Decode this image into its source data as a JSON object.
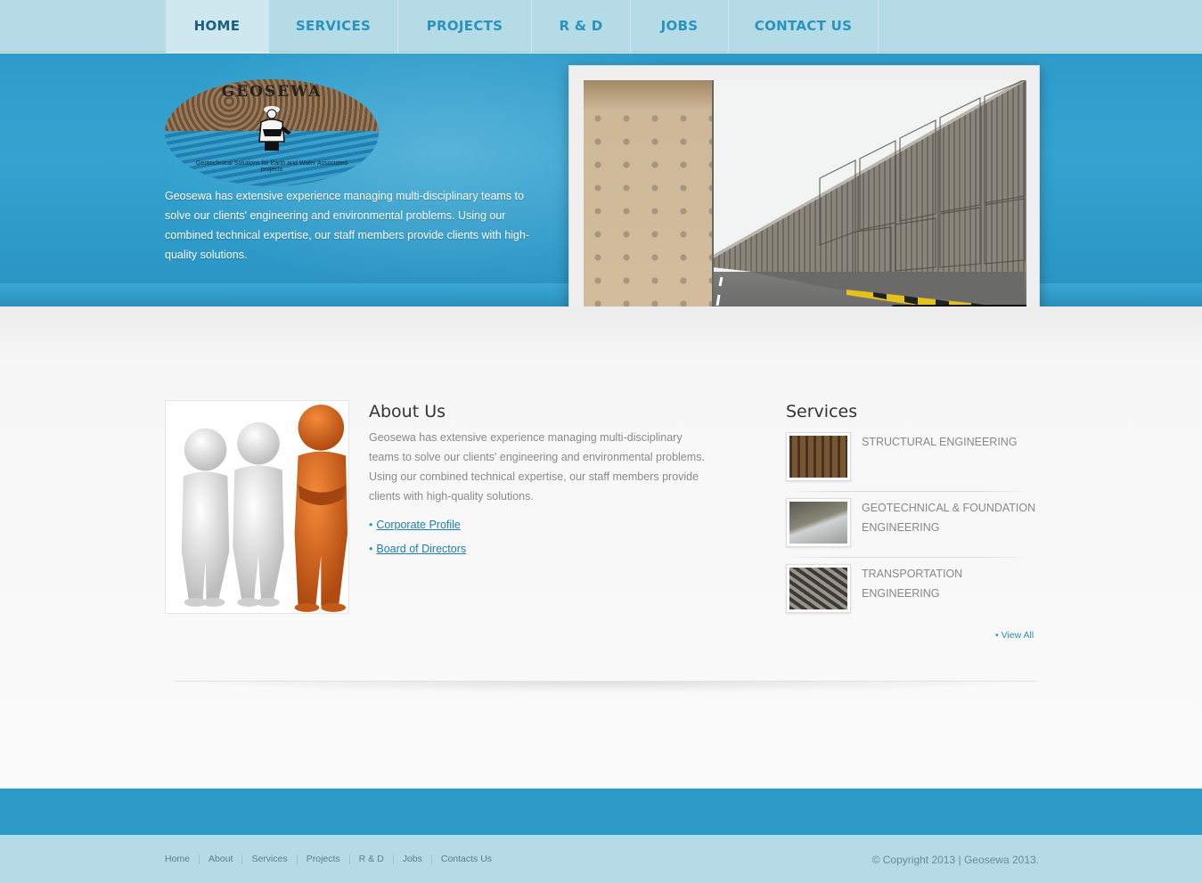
{
  "nav": {
    "items": [
      {
        "label": "HOME",
        "active": true
      },
      {
        "label": "SERVICES",
        "active": false
      },
      {
        "label": "PROJECTS",
        "active": false
      },
      {
        "label": "R & D",
        "active": false
      },
      {
        "label": "JOBS",
        "active": false
      },
      {
        "label": "CONTACT US",
        "active": false
      }
    ]
  },
  "hero": {
    "logo_wordmark": "GEOSEWA",
    "logo_tagline": "Geotechnical Solutions for Earth and Water Associated projects",
    "text": "Geosewa has extensive experience managing multi-disciplinary teams to solve our clients' engineering and environmental problems. Using our combined technical expertise, our staff members provide clients with high-quality solutions.",
    "slider": {
      "slide_count": 6,
      "active_index": 3
    }
  },
  "about": {
    "title": "About Us",
    "text": "Geosewa has extensive experience managing multi-disciplinary teams to solve our clients' engineering and environmental problems. Using our combined technical expertise, our staff members provide clients with high-quality solutions.",
    "links": [
      "Corporate Profile",
      "Board of Directors"
    ]
  },
  "services": {
    "title": "Services",
    "items": [
      "STRUCTURAL ENGINEERING",
      "GEOTECHNICAL & FOUNDATION ENGINEERING",
      "TRANSPORTATION ENGINEERING"
    ],
    "view_all": "View All"
  },
  "footer": {
    "links": [
      "Home",
      "About",
      "Services",
      "Projects",
      "R & D",
      "Jobs",
      "Contacts Us"
    ],
    "copyright": "© Copyright 2013   |   Geosewa 2013."
  },
  "colors": {
    "nav_bg": "#b5dbe6",
    "hero_blue": "#2e9ccb",
    "accent_link": "#1f7fa8",
    "footer_band": "#2c9bc8",
    "active_dot": "#1f86b8"
  }
}
